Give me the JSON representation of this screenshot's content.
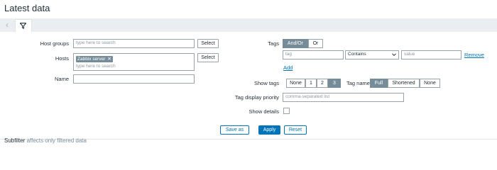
{
  "page": {
    "title": "Latest data"
  },
  "tabs": {
    "prev_icon": "chevron-left-icon",
    "filter_icon": "filter-icon"
  },
  "filter": {
    "host_groups": {
      "label": "Host groups",
      "placeholder": "type here to search",
      "select_label": "Select"
    },
    "hosts": {
      "label": "Hosts",
      "chips": [
        {
          "label": "Zabbix server",
          "remove": "✕"
        }
      ],
      "placeholder": "type here to search",
      "select_label": "Select"
    },
    "name": {
      "label": "Name",
      "value": ""
    },
    "tags": {
      "label": "Tags",
      "operator_options": [
        {
          "label": "And/Or",
          "selected": true
        },
        {
          "label": "Or",
          "selected": false
        }
      ],
      "rows": [
        {
          "tag_placeholder": "tag",
          "operator": "Contains",
          "value_placeholder": "value",
          "remove_label": "Remove"
        }
      ],
      "add_label": "Add"
    },
    "show_tags": {
      "label": "Show tags",
      "options": [
        {
          "label": "None",
          "selected": false
        },
        {
          "label": "1",
          "selected": false
        },
        {
          "label": "2",
          "selected": false
        },
        {
          "label": "3",
          "selected": true
        }
      ]
    },
    "tag_name": {
      "label": "Tag name",
      "options": [
        {
          "label": "Full",
          "selected": true
        },
        {
          "label": "Shortened",
          "selected": false
        },
        {
          "label": "None",
          "selected": false
        }
      ]
    },
    "tag_display_priority": {
      "label": "Tag display priority",
      "placeholder": "comma-separated list"
    },
    "show_details": {
      "label": "Show details",
      "checked": false
    },
    "actions": {
      "save_as": "Save as",
      "apply": "Apply",
      "reset": "Reset"
    }
  },
  "subfilter": {
    "label": "Subfilter",
    "note": "affects only filtered data"
  },
  "colors": {
    "accent": "#0275b8",
    "segment_on": "#768d99",
    "tabbar": "#ebeef0"
  }
}
